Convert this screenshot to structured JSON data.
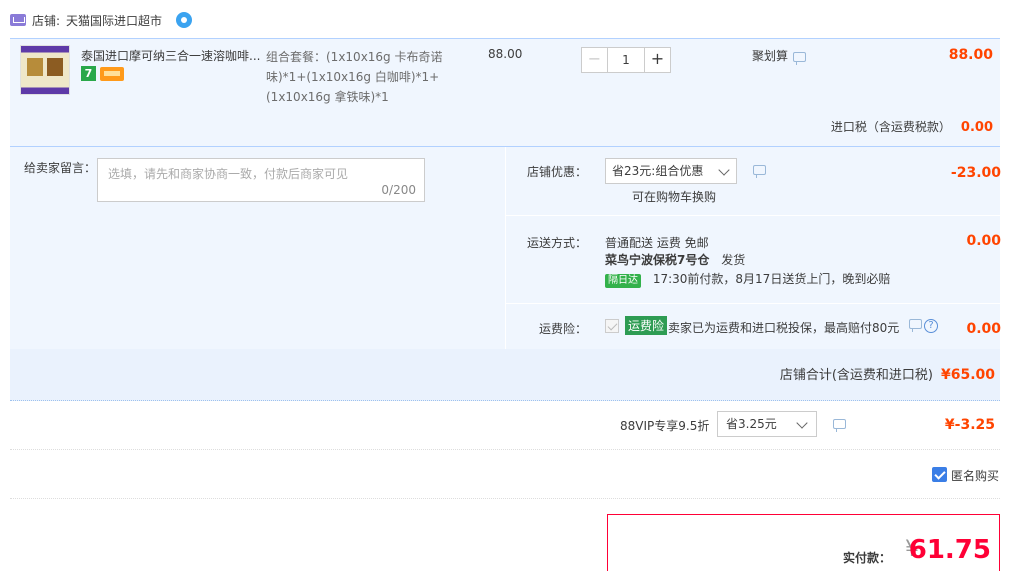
{
  "shop": {
    "label": "店铺:",
    "name": "天猫国际进口超市"
  },
  "item": {
    "title": "泰国进口摩可纳三合一速溶咖啡...",
    "badge_7": "7",
    "spec": "组合套餐：(1x10x16g 卡布奇诺味)*1+(1x10x16g 白咖啡)*1+(1x10x16g 拿铁味)*1",
    "price": "88.00",
    "quantity": "1",
    "qty_minus": "−",
    "qty_plus": "+",
    "promo": "聚划算",
    "total": "88.00"
  },
  "tax": {
    "label": "进口税（含运费税款）",
    "value": "0.00"
  },
  "message": {
    "label": "给卖家留言：",
    "placeholder": "选填，请先和商家协商一致，付款后商家可见",
    "count": "0/200"
  },
  "discount": {
    "label": "店铺优惠：",
    "selected": "省23元:组合优惠",
    "sub": "可在购物车换购",
    "value": "-23.00"
  },
  "shipping": {
    "label": "运送方式：",
    "line1": "普通配送 运费 免邮",
    "line2_bold": "菜鸟宁波保税7号仓",
    "line2_rest": "发货",
    "next_day_tag": "隔日达",
    "delivery_note": "17:30前付款，8月17日送货上门，晚到必赔",
    "value": "0.00"
  },
  "insurance": {
    "label": "运费险：",
    "tag": "运费险",
    "desc": "卖家已为运费和进口税投保，最高赔付80元",
    "help": "?",
    "value": "0.00"
  },
  "shop_total": {
    "label": "店铺合计(含运费和进口税)",
    "value": "¥65.00"
  },
  "vip": {
    "label": "88VIP专享9.5折",
    "selected": "省3.25元",
    "value": "¥-3.25"
  },
  "anonymous": {
    "label": "匿名购买"
  },
  "payment": {
    "label": "实付款：",
    "currency": "¥",
    "value": "61.75"
  },
  "colors": {
    "accent_red": "#ff0036",
    "price_orange": "#ff4400",
    "panel_blue": "#f0f6fe",
    "checkbox_blue": "#3a7ee6",
    "tag_green": "#2e9c53"
  }
}
